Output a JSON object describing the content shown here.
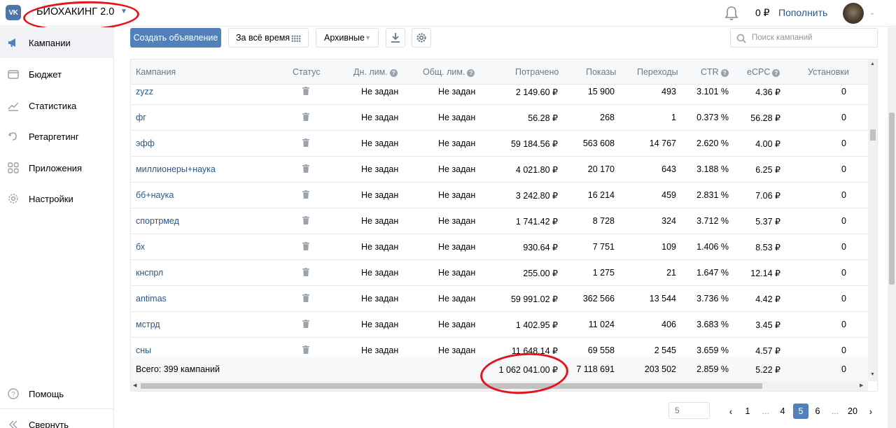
{
  "header": {
    "cabinet_name": "БИОХАКИНГ 2.0",
    "balance": "0 ₽",
    "topup_label": "Пополнить"
  },
  "sidebar": {
    "items": [
      {
        "label": "Кампании",
        "icon": "megaphone-icon",
        "active": true
      },
      {
        "label": "Бюджет",
        "icon": "wallet-icon",
        "active": false
      },
      {
        "label": "Статистика",
        "icon": "chart-icon",
        "active": false
      },
      {
        "label": "Ретаргетинг",
        "icon": "retarget-icon",
        "active": false
      },
      {
        "label": "Приложения",
        "icon": "apps-icon",
        "active": false
      },
      {
        "label": "Настройки",
        "icon": "gear-icon",
        "active": false
      }
    ],
    "help_label": "Помощь",
    "collapse_label": "Свернуть"
  },
  "toolbar": {
    "create_label": "Создать объявление",
    "period_label": "За всё время",
    "archive_label": "Архивные",
    "search_placeholder": "Поиск кампаний"
  },
  "table": {
    "columns": [
      "Кампания",
      "Статус",
      "Дн. лим.",
      "Общ. лим.",
      "Потрачено",
      "Показы",
      "Переходы",
      "CTR",
      "eCPC",
      "Установки"
    ],
    "rows": [
      {
        "name": "zyzz",
        "day_limit": "Не задан",
        "total_limit": "Не задан",
        "spent": "2 149.60 ₽",
        "impressions": "15 900",
        "clicks": "493",
        "ctr": "3.101 %",
        "ecpc": "4.36 ₽",
        "installs": "0"
      },
      {
        "name": "фг",
        "day_limit": "Не задан",
        "total_limit": "Не задан",
        "spent": "56.28 ₽",
        "impressions": "268",
        "clicks": "1",
        "ctr": "0.373 %",
        "ecpc": "56.28 ₽",
        "installs": "0"
      },
      {
        "name": "эфф",
        "day_limit": "Не задан",
        "total_limit": "Не задан",
        "spent": "59 184.56 ₽",
        "impressions": "563 608",
        "clicks": "14 767",
        "ctr": "2.620 %",
        "ecpc": "4.00 ₽",
        "installs": "0"
      },
      {
        "name": "миллионеры+наука",
        "day_limit": "Не задан",
        "total_limit": "Не задан",
        "spent": "4 021.80 ₽",
        "impressions": "20 170",
        "clicks": "643",
        "ctr": "3.188 %",
        "ecpc": "6.25 ₽",
        "installs": "0"
      },
      {
        "name": "бб+наука",
        "day_limit": "Не задан",
        "total_limit": "Не задан",
        "spent": "3 242.80 ₽",
        "impressions": "16 214",
        "clicks": "459",
        "ctr": "2.831 %",
        "ecpc": "7.06 ₽",
        "installs": "0"
      },
      {
        "name": "спортрмед",
        "day_limit": "Не задан",
        "total_limit": "Не задан",
        "spent": "1 741.42 ₽",
        "impressions": "8 728",
        "clicks": "324",
        "ctr": "3.712 %",
        "ecpc": "5.37 ₽",
        "installs": "0"
      },
      {
        "name": "бх",
        "day_limit": "Не задан",
        "total_limit": "Не задан",
        "spent": "930.64 ₽",
        "impressions": "7 751",
        "clicks": "109",
        "ctr": "1.406 %",
        "ecpc": "8.53 ₽",
        "installs": "0"
      },
      {
        "name": "кнспрл",
        "day_limit": "Не задан",
        "total_limit": "Не задан",
        "spent": "255.00 ₽",
        "impressions": "1 275",
        "clicks": "21",
        "ctr": "1.647 %",
        "ecpc": "12.14 ₽",
        "installs": "0"
      },
      {
        "name": "antimas",
        "day_limit": "Не задан",
        "total_limit": "Не задан",
        "spent": "59 991.02 ₽",
        "impressions": "362 566",
        "clicks": "13 544",
        "ctr": "3.736 %",
        "ecpc": "4.42 ₽",
        "installs": "0"
      },
      {
        "name": "мстрд",
        "day_limit": "Не задан",
        "total_limit": "Не задан",
        "spent": "1 402.95 ₽",
        "impressions": "11 024",
        "clicks": "406",
        "ctr": "3.683 %",
        "ecpc": "3.45 ₽",
        "installs": "0"
      },
      {
        "name": "сны",
        "day_limit": "Не задан",
        "total_limit": "Не задан",
        "spent": "11 648.14 ₽",
        "impressions": "69 558",
        "clicks": "2 545",
        "ctr": "3.659 %",
        "ecpc": "4.57 ₽",
        "installs": "0"
      }
    ],
    "totals": {
      "label": "Всего: 399 кампаний",
      "spent": "1 062 041.00 ₽",
      "impressions": "7 118 691",
      "clicks": "203 502",
      "ctr": "2.859 %",
      "ecpc": "5.22 ₽",
      "installs": "0"
    }
  },
  "pagination": {
    "per_page_placeholder": "5",
    "pages": [
      "1",
      "...",
      "4",
      "5",
      "6",
      "...",
      "20"
    ],
    "current": "5"
  },
  "colors": {
    "accent": "#5181b8",
    "link": "#2a5885",
    "annotation": "#e2141b"
  }
}
